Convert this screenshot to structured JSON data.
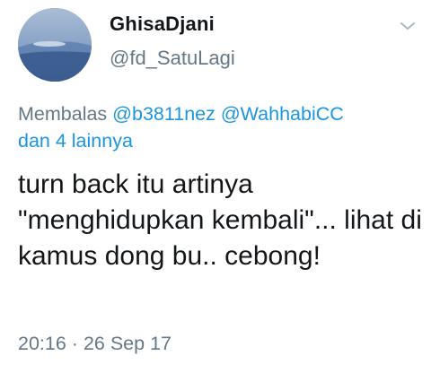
{
  "user": {
    "display_name": "GhisaDjani",
    "handle": "@fd_SatuLagi"
  },
  "reply": {
    "prefix": "Membalas",
    "mentions": [
      "@b3811nez",
      "@WahhabiCC"
    ],
    "others": "dan 4 lainnya"
  },
  "tweet": {
    "text": "turn back itu artinya \"menghidupkan kembali\"... lihat di kamus dong bu.. cebong!"
  },
  "meta": {
    "time": "20:16",
    "separator": "·",
    "date": "26 Sep 17"
  },
  "icons": {
    "avatar": "sky-horizon-avatar",
    "menu": "chevron-down-icon"
  },
  "colors": {
    "text": "#14171a",
    "secondary": "#657786",
    "link": "#1b95e0"
  }
}
